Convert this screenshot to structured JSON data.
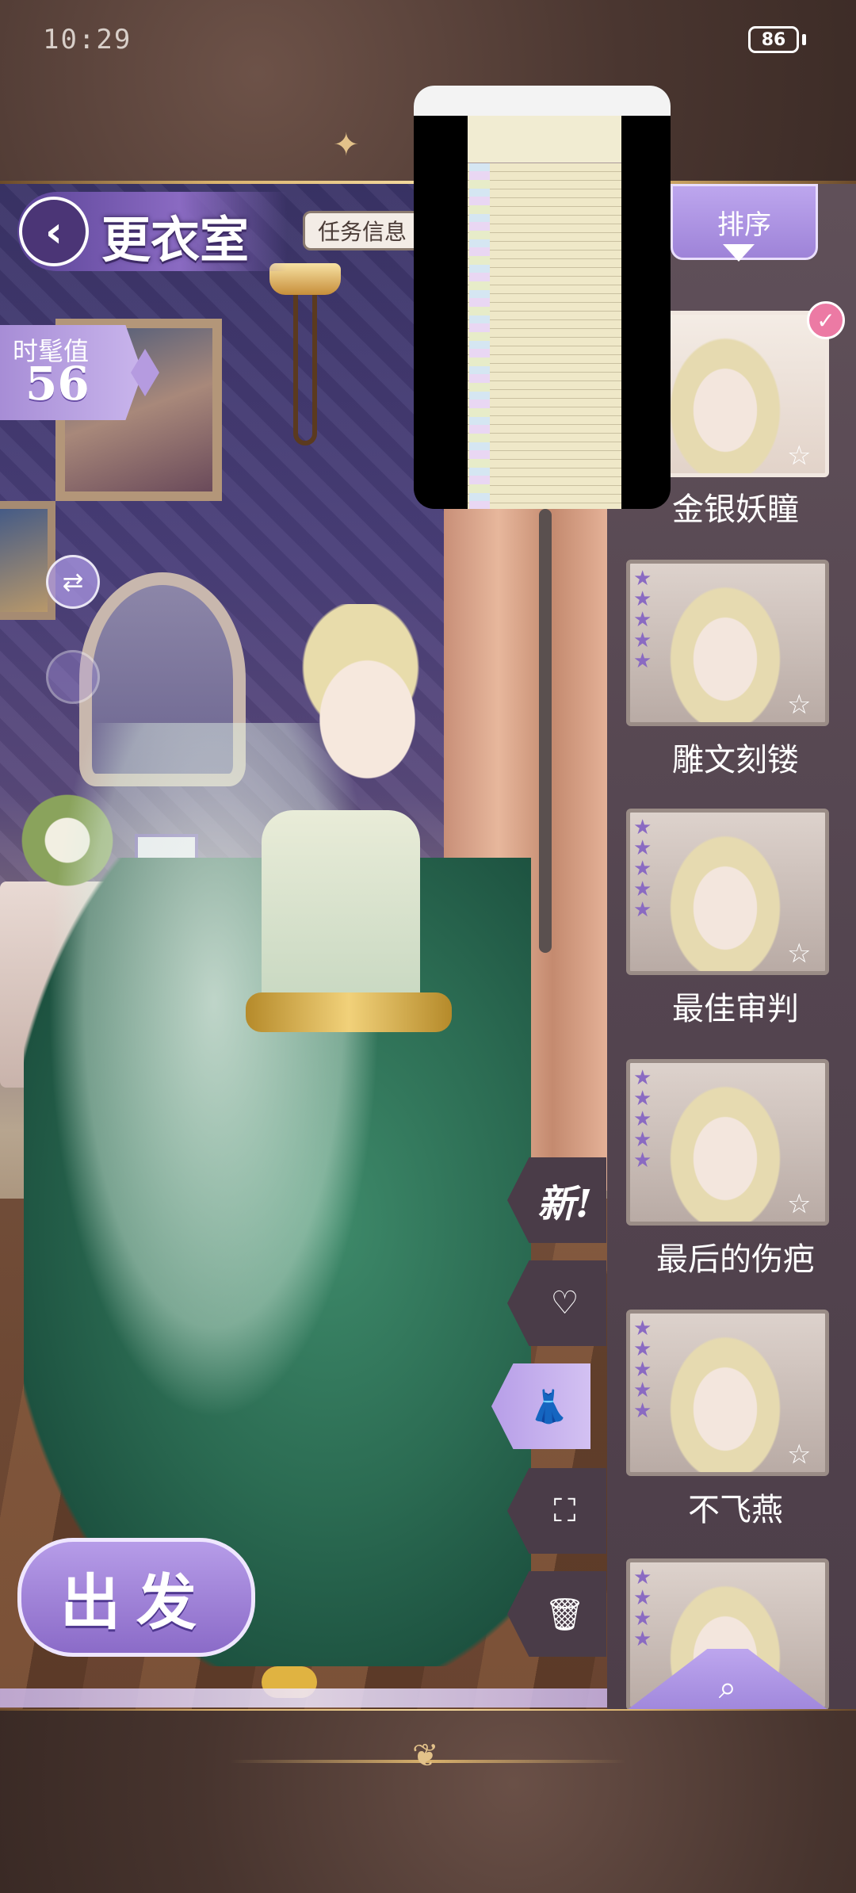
{
  "status_bar": {
    "time": "10:29",
    "battery": "86"
  },
  "header": {
    "back_icon": "chevron-left-icon",
    "title": "更衣室",
    "task_button": "任务信息"
  },
  "fashion": {
    "label": "时髦值",
    "value": "56"
  },
  "left_icons": {
    "refresh_icon": "swap-icon",
    "magic_icon": "bubble-icon"
  },
  "go_button": "出发",
  "side_buttons": [
    {
      "label": "新!",
      "icon": "new-icon"
    },
    {
      "label": "",
      "icon": "heart-icon",
      "glyph": "♡"
    },
    {
      "label": "",
      "icon": "dress-icon",
      "glyph": "👗"
    },
    {
      "label": "",
      "icon": "expand-icon",
      "glyph": "⛶"
    },
    {
      "label": "",
      "icon": "trash-icon",
      "glyph": "🗑"
    }
  ],
  "panel": {
    "sort_label": "排序",
    "items": [
      {
        "name": "金银妖瞳",
        "selected": true
      },
      {
        "name": "雕文刻镂",
        "selected": false
      },
      {
        "name": "最佳审判",
        "selected": false
      },
      {
        "name": "最后的伤疤",
        "selected": false
      },
      {
        "name": "不飞燕",
        "selected": false
      }
    ],
    "search_icon": "search-icon"
  },
  "preview_window": {
    "kind": "spreadsheet-thumbnail"
  },
  "colors": {
    "accent": "#8a6ac2",
    "panel": "#544550",
    "selected_badge": "#ec7aa4"
  }
}
